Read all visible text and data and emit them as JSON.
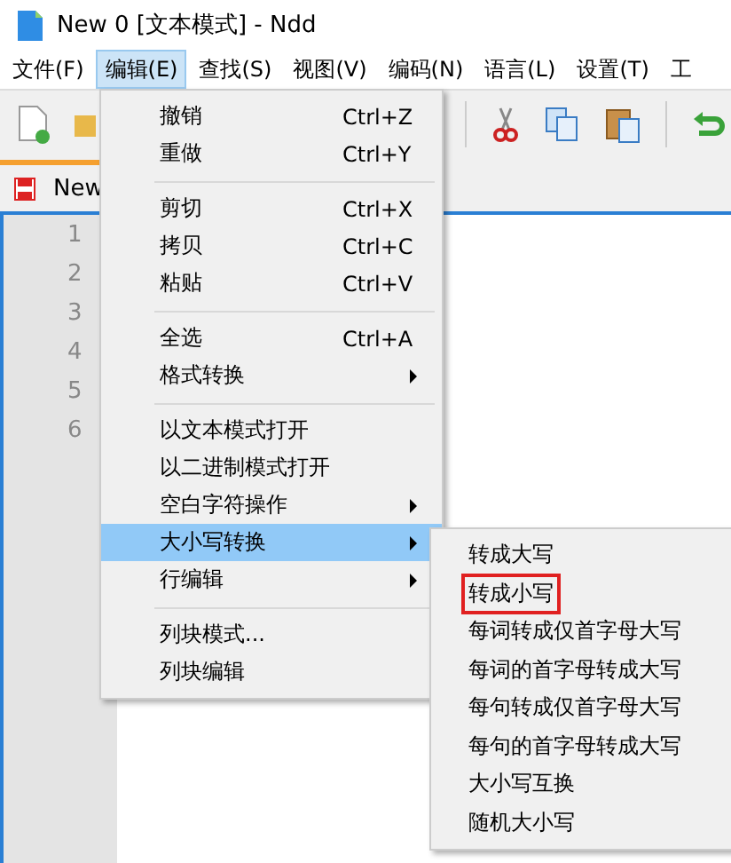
{
  "window": {
    "title": "New 0 [文本模式] - Ndd"
  },
  "menubar": [
    {
      "label": "文件(F)",
      "selected": false
    },
    {
      "label": "编辑(E)",
      "selected": true
    },
    {
      "label": "查找(S)",
      "selected": false
    },
    {
      "label": "视图(V)",
      "selected": false
    },
    {
      "label": "编码(N)",
      "selected": false
    },
    {
      "label": "语言(L)",
      "selected": false
    },
    {
      "label": "设置(T)",
      "selected": false
    },
    {
      "label": "工",
      "selected": false
    }
  ],
  "tab": {
    "label": "New"
  },
  "line_numbers": [
    "1",
    "2",
    "3",
    "4",
    "5",
    "6"
  ],
  "edit_menu": [
    {
      "kind": "item",
      "label": "撤销",
      "shortcut": "Ctrl+Z",
      "submenu": false,
      "selected": false
    },
    {
      "kind": "item",
      "label": "重做",
      "shortcut": "Ctrl+Y",
      "submenu": false,
      "selected": false
    },
    {
      "kind": "separator"
    },
    {
      "kind": "item",
      "label": "剪切",
      "shortcut": "Ctrl+X",
      "submenu": false,
      "selected": false
    },
    {
      "kind": "item",
      "label": "拷贝",
      "shortcut": "Ctrl+C",
      "submenu": false,
      "selected": false
    },
    {
      "kind": "item",
      "label": "粘贴",
      "shortcut": "Ctrl+V",
      "submenu": false,
      "selected": false
    },
    {
      "kind": "separator"
    },
    {
      "kind": "item",
      "label": "全选",
      "shortcut": "Ctrl+A",
      "submenu": false,
      "selected": false
    },
    {
      "kind": "item",
      "label": "格式转换",
      "submenu": true,
      "selected": false
    },
    {
      "kind": "separator"
    },
    {
      "kind": "item",
      "label": "以文本模式打开",
      "submenu": false,
      "selected": false
    },
    {
      "kind": "item",
      "label": "以二进制模式打开",
      "submenu": false,
      "selected": false
    },
    {
      "kind": "item",
      "label": "空白字符操作",
      "submenu": true,
      "selected": false
    },
    {
      "kind": "item",
      "label": "大小写转换",
      "submenu": true,
      "selected": true
    },
    {
      "kind": "item",
      "label": "行编辑",
      "submenu": true,
      "selected": false
    },
    {
      "kind": "separator"
    },
    {
      "kind": "item",
      "label": "列块模式...",
      "submenu": false,
      "selected": false
    },
    {
      "kind": "item",
      "label": "列块编辑",
      "submenu": false,
      "selected": false
    }
  ],
  "case_submenu": [
    {
      "label": "转成大写",
      "boxed": false
    },
    {
      "label": "转成小写",
      "boxed": true
    },
    {
      "label": "每词转成仅首字母大写",
      "boxed": false
    },
    {
      "label": "每词的首字母转成大写",
      "boxed": false
    },
    {
      "label": "每句转成仅首字母大写",
      "boxed": false
    },
    {
      "label": "每句的首字母转成大写",
      "boxed": false
    },
    {
      "label": "大小写互换",
      "boxed": false
    },
    {
      "label": "随机大小写",
      "boxed": false
    }
  ]
}
